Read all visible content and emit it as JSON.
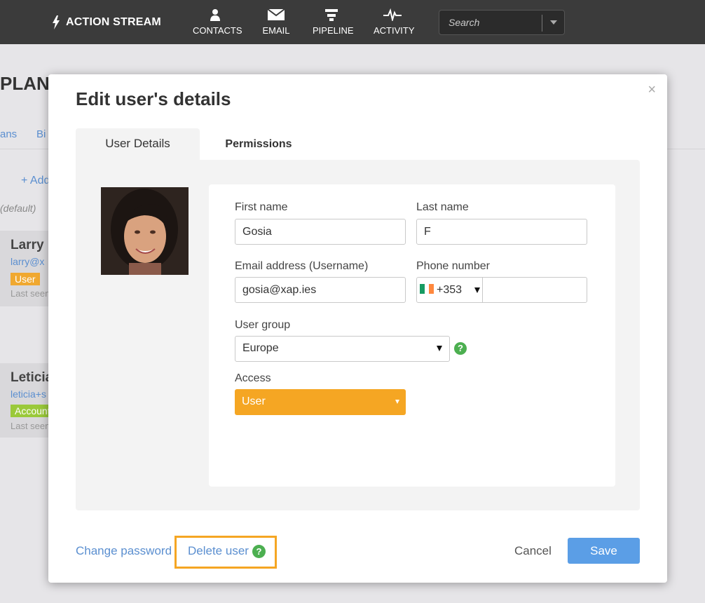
{
  "topbar": {
    "brand": "ACTION STREAM",
    "nav": [
      {
        "label": "CONTACTS",
        "icon": "person-icon"
      },
      {
        "label": "EMAIL",
        "icon": "envelope-icon"
      },
      {
        "label": "PIPELINE",
        "icon": "funnel-icon"
      },
      {
        "label": "ACTIVITY",
        "icon": "pulse-icon"
      }
    ],
    "search_placeholder": "Search"
  },
  "background": {
    "title": "PLANS",
    "tabs": [
      "ans",
      "Bi"
    ],
    "add_label": "+ Add",
    "default_label": "(default)",
    "users": [
      {
        "name": "Larry",
        "email": "larry@x",
        "badge": "User",
        "badge_color": "#f0a830",
        "last_seen": "Last seen"
      },
      {
        "name": "Leticia",
        "email": "leticia+s",
        "badge": "Account",
        "badge_color": "#9ac93a",
        "last_seen": "Last seen"
      }
    ]
  },
  "modal": {
    "title": "Edit user's details",
    "close": "×",
    "tabs": [
      "User Details",
      "Permissions"
    ],
    "fields": {
      "first_name_label": "First name",
      "first_name": "Gosia",
      "last_name_label": "Last name",
      "last_name": "F",
      "email_label": "Email address (Username)",
      "email": "gosia@xap.ies",
      "phone_label": "Phone number",
      "phone_code": "+353",
      "phone_number": "",
      "user_group_label": "User group",
      "user_group": "Europe",
      "access_label": "Access",
      "access": "User"
    },
    "help_glyph": "?",
    "footer": {
      "change_password": "Change password",
      "delete_user": "Delete user",
      "cancel": "Cancel",
      "save": "Save"
    }
  },
  "colors": {
    "accent_blue": "#5b9ee6",
    "access_orange": "#f5a623",
    "help_green": "#4caf50",
    "topbar": "#3b3b3b"
  }
}
